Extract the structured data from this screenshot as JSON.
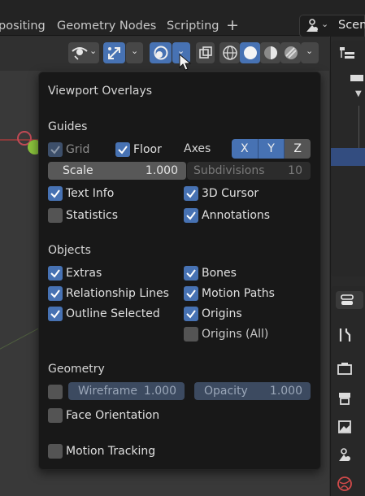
{
  "topbar": {
    "tabs": [
      "positing",
      "Geometry Nodes",
      "Scripting"
    ],
    "add_tab": "+",
    "scene_label": "Scen"
  },
  "header": {
    "icons": [
      "visibility-eye-icon",
      "transform-gizmo-icon",
      "overlays-icon",
      "xray-icon",
      "wireframe-shading-icon",
      "solid-shading-icon",
      "material-shading-icon",
      "rendered-shading-icon"
    ],
    "chevron": "⌄"
  },
  "popover": {
    "title": "Viewport Overlays",
    "guides": {
      "heading": "Guides",
      "grid": {
        "label": "Grid",
        "checked": true
      },
      "floor": {
        "label": "Floor",
        "checked": true
      },
      "axes_label": "Axes",
      "axes": [
        "X",
        "Y",
        "Z"
      ],
      "scale_label": "Scale",
      "scale_value": "1.000",
      "subdivisions_label": "Subdivisions",
      "subdivisions_value": "10",
      "text_info": {
        "label": "Text Info",
        "checked": true
      },
      "cursor_3d": {
        "label": "3D Cursor",
        "checked": true
      },
      "statistics": {
        "label": "Statistics",
        "checked": false
      },
      "annotations": {
        "label": "Annotations",
        "checked": true
      }
    },
    "objects": {
      "heading": "Objects",
      "extras": {
        "label": "Extras",
        "checked": true
      },
      "bones": {
        "label": "Bones",
        "checked": true
      },
      "relationship_lines": {
        "label": "Relationship Lines",
        "checked": true
      },
      "motion_paths": {
        "label": "Motion Paths",
        "checked": true
      },
      "outline_selected": {
        "label": "Outline Selected",
        "checked": true
      },
      "origins": {
        "label": "Origins",
        "checked": true
      },
      "origins_all": {
        "label": "Origins (All)",
        "checked": false
      }
    },
    "geometry": {
      "heading": "Geometry",
      "wireframe_label": "Wireframe",
      "wireframe_value": "1.000",
      "opacity_label": "Opacity",
      "opacity_value": "1.000",
      "face_orientation": {
        "label": "Face Orientation",
        "checked": false
      }
    },
    "motion_tracking": {
      "label": "Motion Tracking",
      "checked": false
    }
  },
  "colors": {
    "accent": "#4772b3",
    "popover_bg": "#181818",
    "checkbox_off": "#545454"
  }
}
